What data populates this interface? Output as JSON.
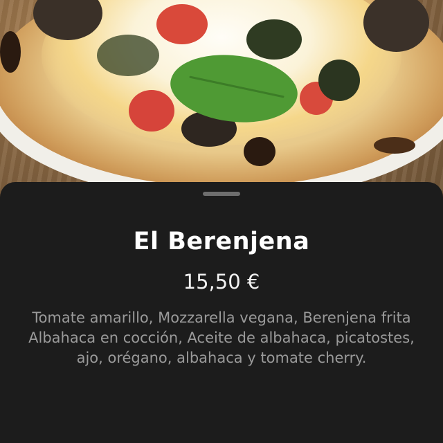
{
  "product": {
    "name": "El Berenjena",
    "price": "15,50 €",
    "description": "Tomate amarillo, Mozzarella vegana, Berenjena frita Albahaca en cocción, Aceite de albahaca, picatostes, ajo, orégano, albahaca y tomate cherry."
  },
  "colors": {
    "sheet_background": "#1c1c1c",
    "title_text": "#ffffff",
    "description_text": "#9a9a9a",
    "handle": "#6e6e6e"
  }
}
